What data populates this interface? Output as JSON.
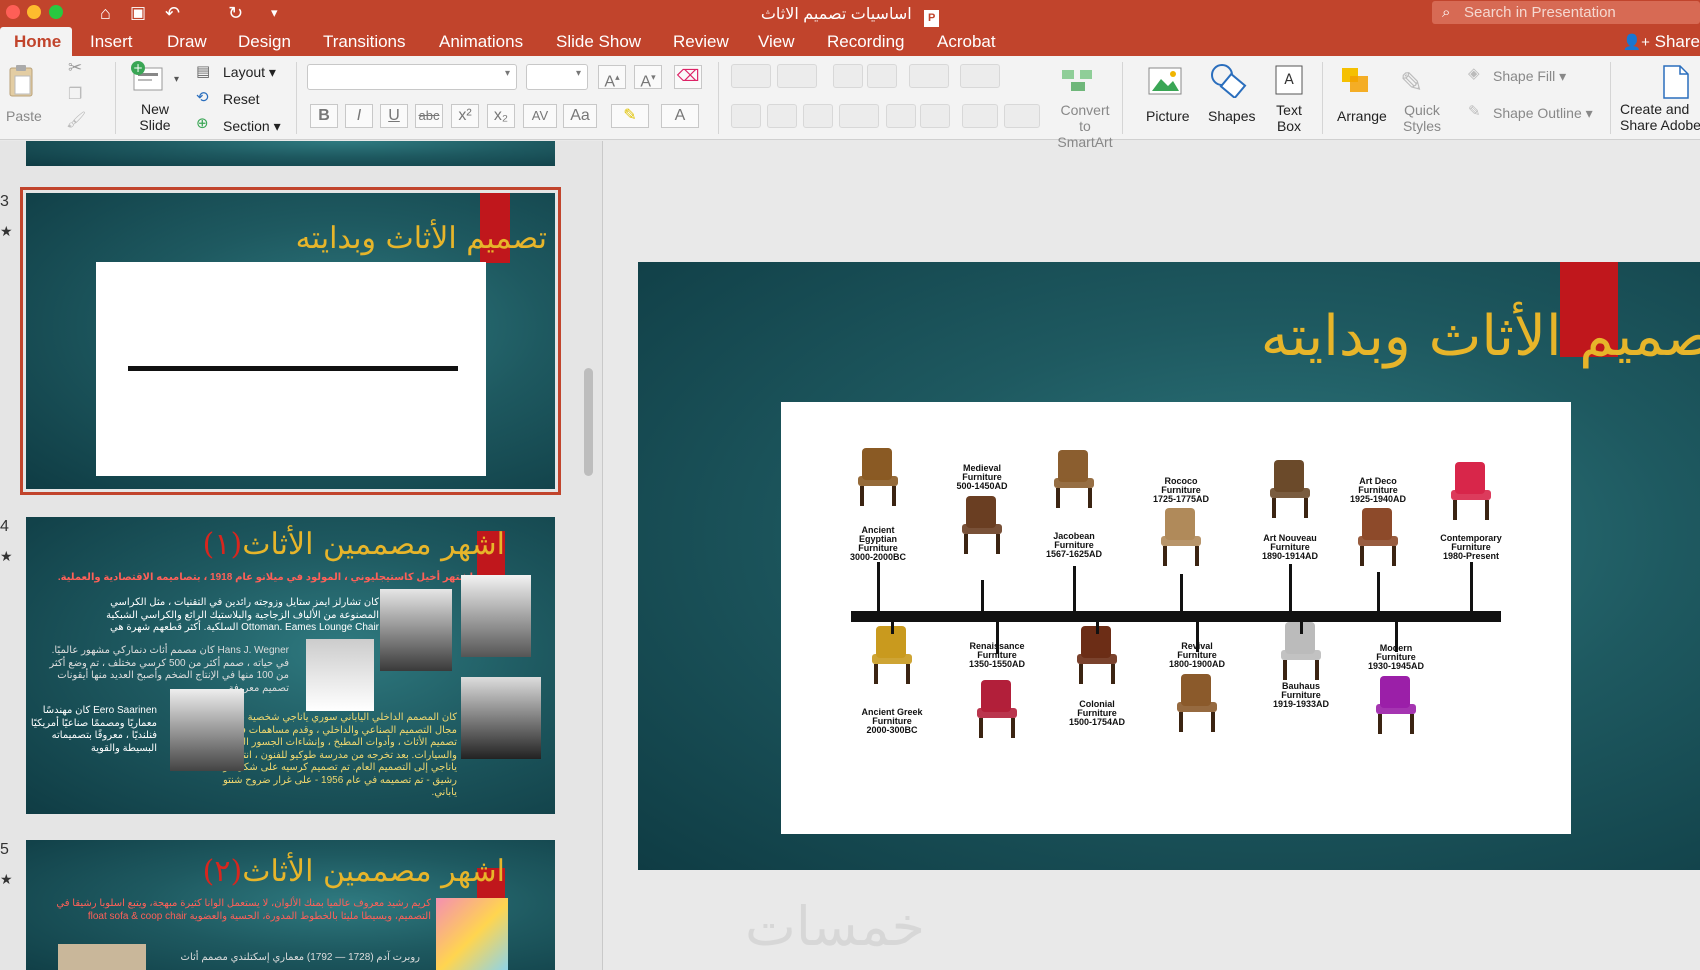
{
  "window": {
    "doc_title": "اساسيات تصميم الاثاث",
    "search_placeholder": "Search in Presentation"
  },
  "tabs": [
    "Home",
    "Insert",
    "Draw",
    "Design",
    "Transitions",
    "Animations",
    "Slide Show",
    "Review",
    "View",
    "Recording",
    "Acrobat"
  ],
  "share_label": "Share",
  "ribbon": {
    "paste": "Paste",
    "new_slide": "New Slide",
    "layout": "Layout",
    "reset": "Reset",
    "section": "Section",
    "convert": "Convert to SmartArt",
    "picture": "Picture",
    "shapes": "Shapes",
    "text_box": "Text Box",
    "arrange": "Arrange",
    "quick_styles": "Quick Styles",
    "shape_fill": "Shape Fill",
    "shape_outline": "Shape Outline",
    "create_pdf": "Create and Share Adobe PDF"
  },
  "slides": {
    "s3": {
      "num": "3",
      "title": "تصميم الأثاث وبدايته"
    },
    "s4": {
      "num": "4",
      "title": "اشهر مصممين الأثاث",
      "title_num": "(١)",
      "line1": "اشتهر أخيل كاستيجليوني ، المولود في ميلانو عام 1918 ، بتصاميمه الاقتصادية والعملية.",
      "p1a": "كان تشارلز ايمز ستايل وزوجته رائدين في التقنيات ، مثل الكراسي",
      "p1b": "المصنوعة من الألياف الزجاجية والبلاستيك الرائع والكراسي الشبكية",
      "p1c": "Ottoman. Eames Lounge Chair السلكية. أكثر قطعهم شهرة هي",
      "p2a": "Hans J. Wegner كان مصمم أثاث دنماركي مشهور عالميًا.",
      "p2b": "في حياته ، صمم أكثر من 500 كرسي مختلف ، تم وضع أكثر",
      "p2c": "من 100 منها في الإنتاج الضخم وأصبح العديد منها أيقونات",
      "p2d": "تصميم معروفة.",
      "p3a": "Eero Saarinen كان مهندسًا",
      "p3b": "معماريًا ومصممًا صناعيًا أمريكيًا",
      "p3c": "فنلنديًا ، معروفًا بتصميماته",
      "p3d": "البسيطة والقوية",
      "p4a": "كان المصمم الداخلي الياباني سوري ياناجي شخصية بارزة في",
      "p4b": "مجال التصميم الصناعي والداخلي ، وقدم مساهمات في",
      "p4c": "تصميم الأثاث ، وأدوات المطبخ ، وإنشاءات الجسور الثقيلة",
      "p4d": "والسيارات. بعد تخرجه من مدرسة طوكيو للفنون ، انتقل",
      "p4e": "ياناجي إلى التصميم العام. تم تصميم كرسيه على شكل فراشة",
      "p4f": "رشيق - تم تصميمه في عام 1956 - على غرار ضروح شنتو",
      "p4g": "ياباني."
    },
    "s5": {
      "num": "5",
      "title": "اشهر مصممين الأثاث",
      "title_num": "(٢)",
      "line1": "كريم رشيد معروف عالميا بمنك الألوان، لا يستعمل الوانا كثيرة مبهجة، ويتبع اسلوبا رشيقا في",
      "line2": "التصميم، ويسيطا مليئا بالخطوط المدورة، الحسية والعضوية float sofa & coop chair",
      "line3": "روبرت آدم (1728 — 1792) معماري إسكتلندي مصمم أثاث"
    }
  },
  "main_slide_title": "تصميم الأثاث وبدايته",
  "timeline": {
    "top": [
      {
        "name": "Ancient Egyptian Furniture",
        "dates": "3000-2000BC"
      },
      {
        "name": "Medieval Furniture",
        "dates": "500-1450AD"
      },
      {
        "name": "Jacobean Furniture",
        "dates": "1567-1625AD"
      },
      {
        "name": "Rococo Furniture",
        "dates": "1725-1775AD"
      },
      {
        "name": "Art Nouveau Furniture",
        "dates": "1890-1914AD"
      },
      {
        "name": "Art Deco Furniture",
        "dates": "1925-1940AD"
      },
      {
        "name": "Contemporary Furniture",
        "dates": "1980-Present"
      }
    ],
    "bottom": [
      {
        "name": "Ancient Greek Furniture",
        "dates": "2000-300BC"
      },
      {
        "name": "Renaissance Furniture",
        "dates": "1350-1550AD"
      },
      {
        "name": "Colonial Furniture",
        "dates": "1500-1754AD"
      },
      {
        "name": "Revival Furniture",
        "dates": "1800-1900AD"
      },
      {
        "name": "Bauhaus Furniture",
        "dates": "1919-1933AD"
      },
      {
        "name": "Modern Furniture",
        "dates": "1930-1945AD"
      }
    ]
  },
  "watermark": "خمسات"
}
